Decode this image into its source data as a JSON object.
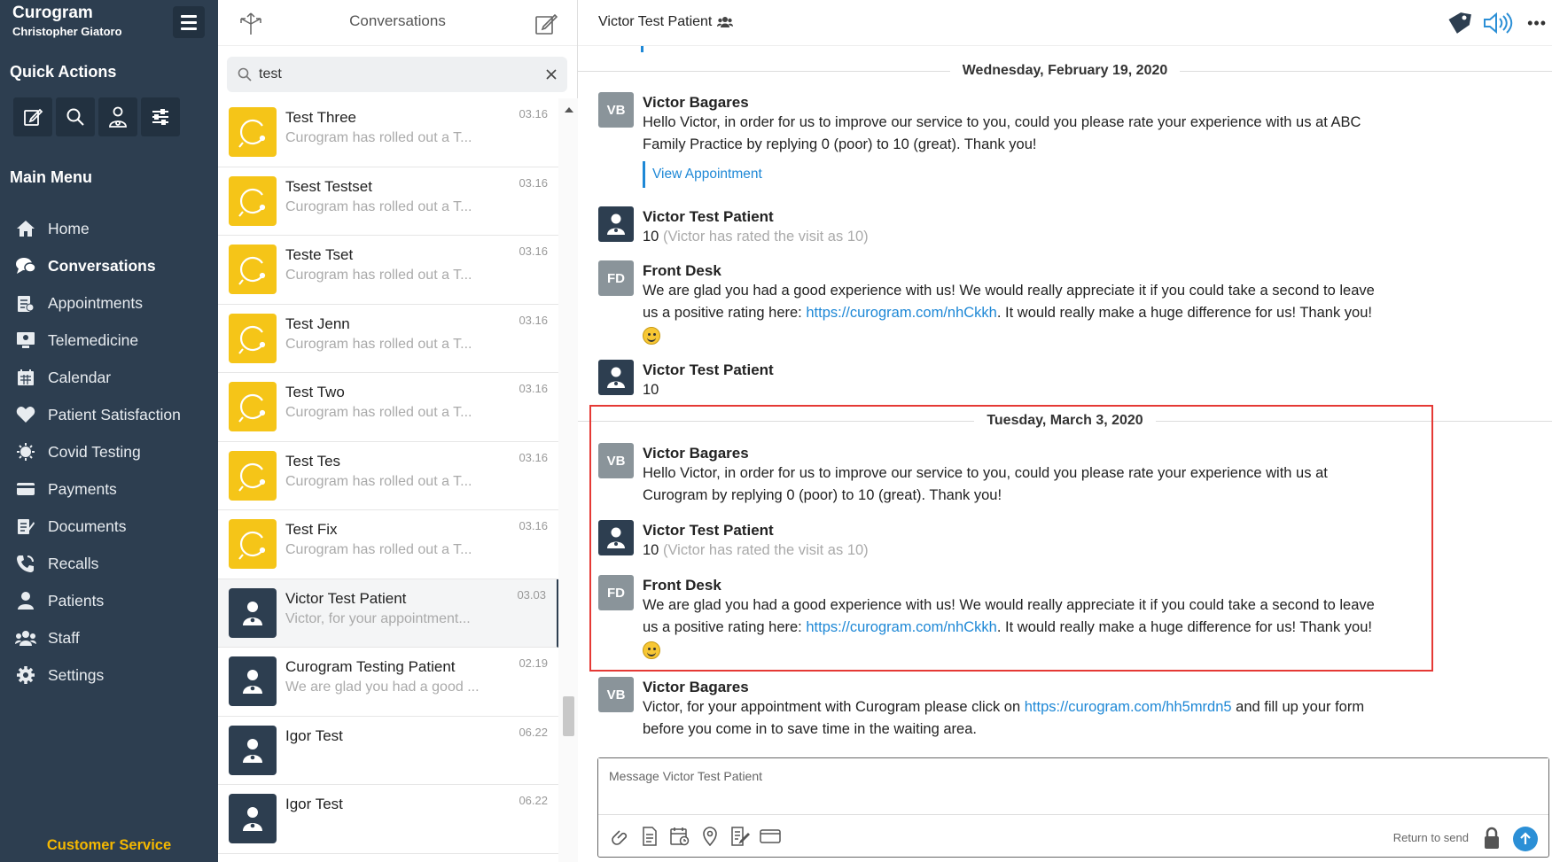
{
  "brand": {
    "title": "Curogram",
    "user": "Christopher Giatoro"
  },
  "sidebar": {
    "quick_actions_title": "Quick Actions",
    "quick_actions": [
      {
        "icon": "compose-icon"
      },
      {
        "icon": "search-icon"
      },
      {
        "icon": "add-patient-icon"
      },
      {
        "icon": "filters-icon"
      }
    ],
    "main_menu_title": "Main Menu",
    "items": [
      {
        "label": "Home",
        "icon": "home-icon"
      },
      {
        "label": "Conversations",
        "icon": "chat-icon",
        "active": true
      },
      {
        "label": "Appointments",
        "icon": "appointments-icon"
      },
      {
        "label": "Telemedicine",
        "icon": "telemedicine-icon"
      },
      {
        "label": "Calendar",
        "icon": "calendar-icon"
      },
      {
        "label": "Patient Satisfaction",
        "icon": "heart-icon"
      },
      {
        "label": "Covid Testing",
        "icon": "virus-icon"
      },
      {
        "label": "Payments",
        "icon": "card-icon"
      },
      {
        "label": "Documents",
        "icon": "documents-icon"
      },
      {
        "label": "Recalls",
        "icon": "phone-icon"
      },
      {
        "label": "Patients",
        "icon": "user-icon"
      },
      {
        "label": "Staff",
        "icon": "staff-icon"
      },
      {
        "label": "Settings",
        "icon": "gear-icon"
      }
    ],
    "customer_service": "Customer Service"
  },
  "conversations": {
    "title": "Conversations",
    "search": {
      "value": "test"
    },
    "items": [
      {
        "name": "Test Three",
        "preview": "Curogram has rolled out a T...",
        "date": "03.16",
        "avatar": "yellow"
      },
      {
        "name": "Tsest Testset",
        "preview": "Curogram has rolled out a T...",
        "date": "03.16",
        "avatar": "yellow"
      },
      {
        "name": "Teste Tset",
        "preview": "Curogram has rolled out a T...",
        "date": "03.16",
        "avatar": "yellow"
      },
      {
        "name": "Test Jenn",
        "preview": "Curogram has rolled out a T...",
        "date": "03.16",
        "avatar": "yellow"
      },
      {
        "name": "Test Two",
        "preview": "Curogram has rolled out a T...",
        "date": "03.16",
        "avatar": "yellow"
      },
      {
        "name": "Test Tes",
        "preview": "Curogram has rolled out a T...",
        "date": "03.16",
        "avatar": "yellow"
      },
      {
        "name": "Test Fix",
        "preview": "Curogram has rolled out a T...",
        "date": "03.16",
        "avatar": "yellow"
      },
      {
        "name": "Victor Test Patient",
        "preview": "Victor, for your appointment...",
        "date": "03.03",
        "avatar": "dark",
        "active": true
      },
      {
        "name": "Curogram Testing Patient",
        "preview": "We are glad you had a good ...",
        "date": "02.19",
        "avatar": "dark"
      },
      {
        "name": "Igor Test",
        "preview": "",
        "date": "06.22",
        "avatar": "dark"
      },
      {
        "name": "Igor Test",
        "preview": "",
        "date": "06.22",
        "avatar": "dark"
      }
    ]
  },
  "chat": {
    "title": "Victor Test Patient",
    "date1": "Wednesday, February 19, 2020",
    "date2": "Tuesday, March 3, 2020",
    "m1": {
      "initials": "VB",
      "sender": "Victor Bagares",
      "text": "Hello Victor, in order for us to improve our service to you, could you please rate your experience with us at ABC Family Practice by replying 0 (poor) to 10 (great). Thank you!",
      "link": "View Appointment"
    },
    "m2": {
      "sender": "Victor Test Patient",
      "value": "10",
      "note": "(Victor has rated the visit as 10)"
    },
    "m3": {
      "initials": "FD",
      "sender": "Front Desk",
      "text_a": "We are glad you had a good experience with us! We would really appreciate it if you could take a second to leave us a positive rating here: ",
      "url": "https://curogram.com/nhCkkh",
      "text_b": ".  It would really make a huge difference for us!  Thank you!"
    },
    "m4": {
      "sender": "Victor Test Patient",
      "text": "10"
    },
    "m5": {
      "initials": "VB",
      "sender": "Victor Bagares",
      "text": "Hello Victor, in order for us to improve our service to you, could you please rate your experience with us at Curogram by replying 0 (poor) to 10 (great). Thank you!"
    },
    "m6": {
      "sender": "Victor Test Patient",
      "value": "10",
      "note": "(Victor has rated the visit as 10)"
    },
    "m7": {
      "initials": "FD",
      "sender": "Front Desk",
      "text_a": "We are glad you had a good experience with us! We would really appreciate it if you could take a second to leave us a positive rating here: ",
      "url": "https://curogram.com/nhCkkh",
      "text_b": ".  It would really make a huge difference for us!  Thank you!"
    },
    "m8": {
      "initials": "VB",
      "sender": "Victor Bagares",
      "text_a": "Victor, for your appointment with Curogram please click on ",
      "url": "https://curogram.com/hh5mrdn5",
      "text_b": " and fill up your form before you come in to save time in the waiting area."
    },
    "composer": {
      "placeholder": "Message Victor Test Patient",
      "return_hint": "Return to send"
    }
  },
  "colors": {
    "sidebar": "#2d3e50",
    "accent": "#1e88d6",
    "brand_yellow": "#f5c518",
    "highlight": "#e53935"
  }
}
